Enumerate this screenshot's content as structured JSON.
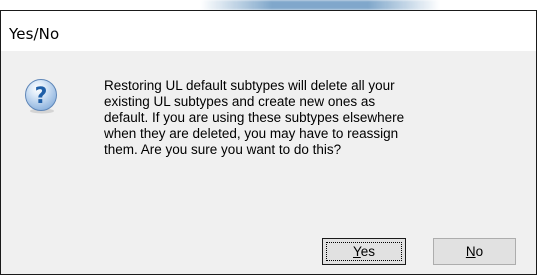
{
  "dialog": {
    "title": "Yes/No",
    "message": "Restoring UL default subtypes will delete all your\nexisting UL subtypes and create new ones as\ndefault.  If you are using these subtypes elsewhere\nwhen they are deleted, you may have to reassign\nthem.  Are you sure you want to do this?",
    "icon": "question-icon",
    "buttons": {
      "yes": {
        "mnemonic": "Y",
        "rest": "es"
      },
      "no": {
        "mnemonic": "N",
        "rest": "o"
      }
    }
  },
  "colors": {
    "client_bg": "#f0f0f0",
    "button_bg": "#e1e1e1",
    "icon_blue": "#1f5fa8"
  }
}
